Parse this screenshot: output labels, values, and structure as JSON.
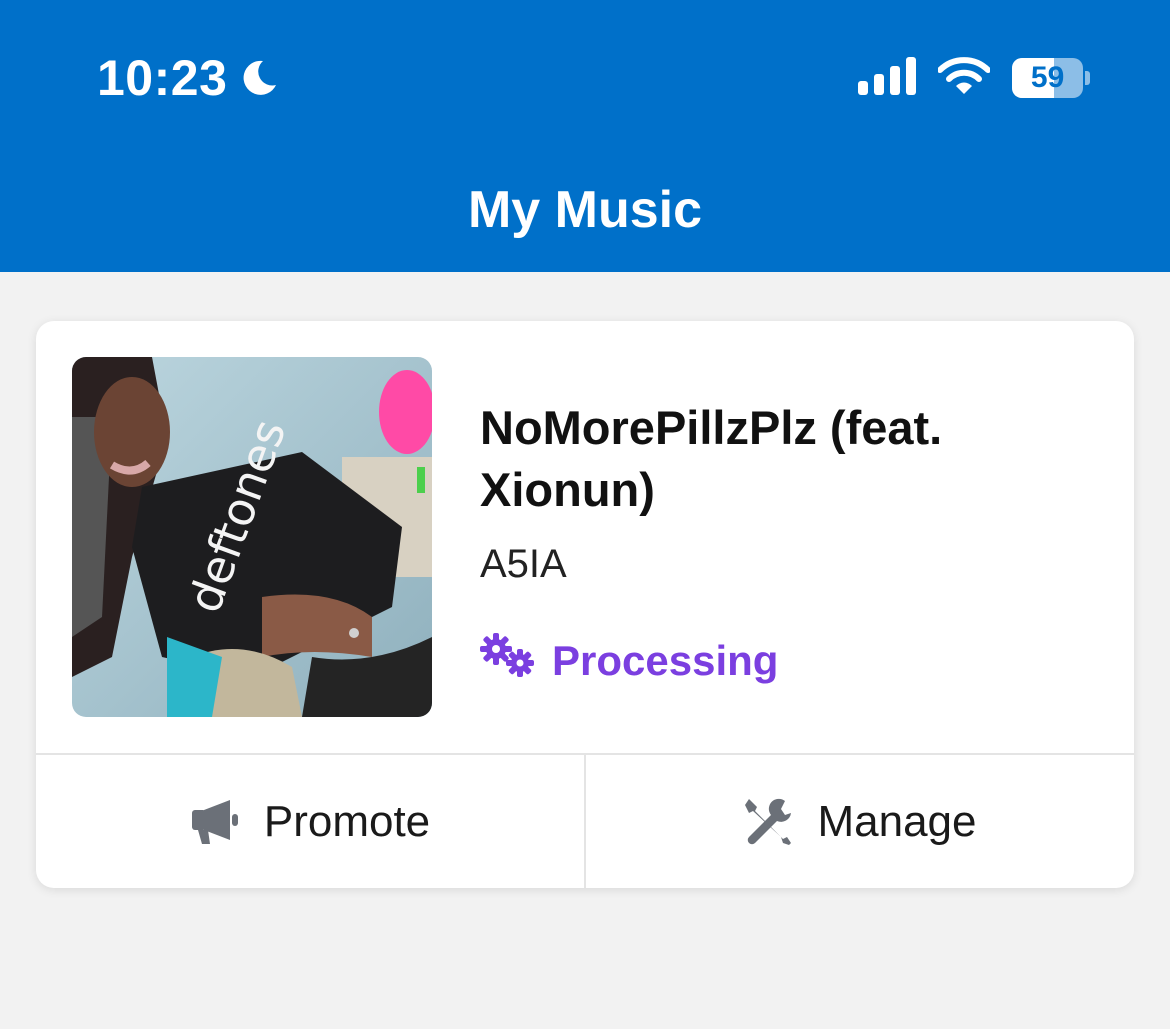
{
  "status_bar": {
    "time": "10:23",
    "battery": "59",
    "battery_level": 0.59,
    "icons": [
      "moon-icon",
      "signal-icon",
      "wifi-icon",
      "battery-icon"
    ]
  },
  "header": {
    "title": "My Music",
    "background": "#0070c9"
  },
  "release": {
    "title": "NoMorePillzPlz (feat. Xionun)",
    "artist": "A5IA",
    "status": "Processing",
    "status_icon": "gears-icon",
    "status_color": "#7b3fe0"
  },
  "actions": {
    "promote_label": "Promote",
    "promote_icon": "megaphone-icon",
    "manage_label": "Manage",
    "manage_icon": "tools-icon"
  }
}
